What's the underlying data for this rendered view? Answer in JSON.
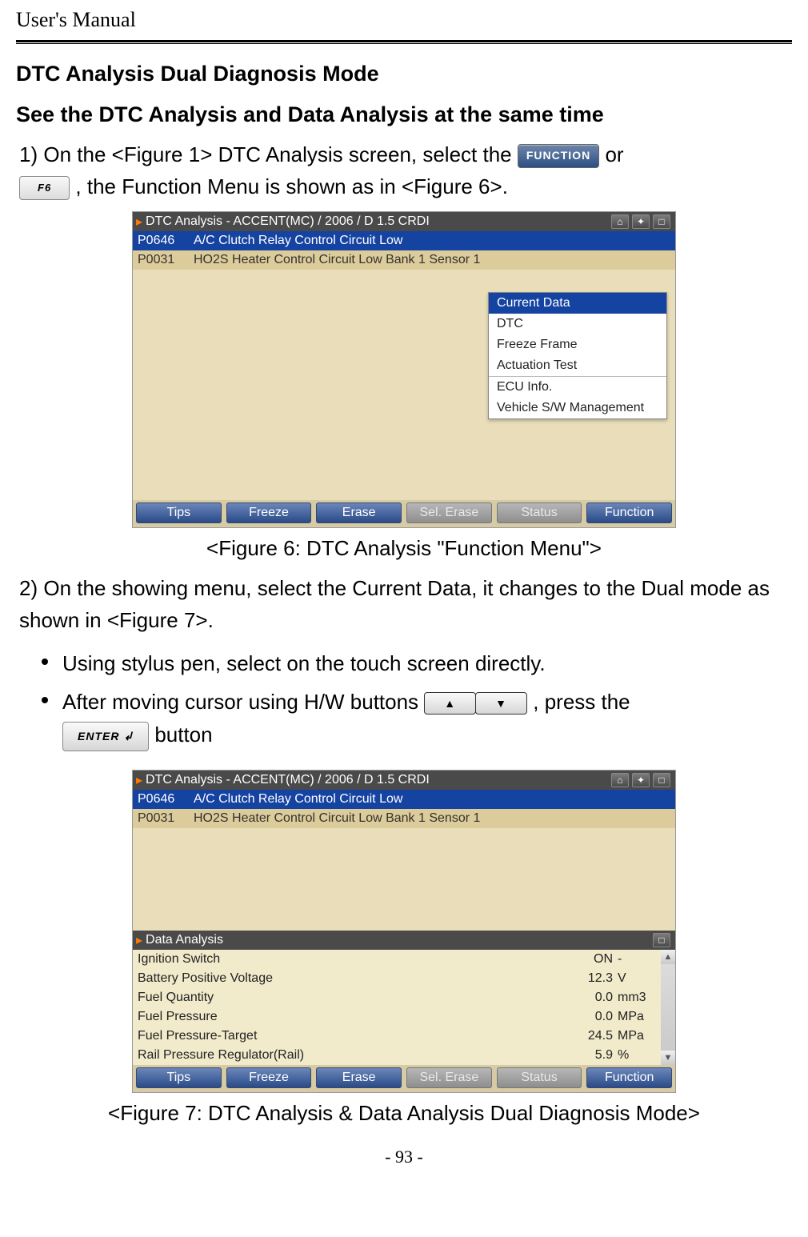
{
  "header": "User's Manual",
  "sectionTitle": "DTC Analysis Dual Diagnosis Mode",
  "subTitle": "See the DTC Analysis and Data Analysis at the same time",
  "step1": {
    "num": "1)",
    "pre": "On the <Figure 1> DTC Analysis screen, select the ",
    "functionLabel": "FUNCTION",
    "post": " or ",
    "f6Label": "F6",
    "tail": ", the Function Menu is shown as in <Figure 6>."
  },
  "panel1": {
    "title": "DTC Analysis - ACCENT(MC) / 2006 / D 1.5 CRDI",
    "dtc": [
      {
        "code": "P0646",
        "desc": "A/C Clutch Relay Control Circuit Low",
        "highlight": true
      },
      {
        "code": "P0031",
        "desc": "HO2S Heater Control Circuit Low Bank 1  Sensor 1",
        "highlight": false
      }
    ],
    "menu": [
      "Current Data",
      "DTC",
      "Freeze Frame",
      "Actuation Test",
      "ECU Info.",
      "Vehicle S/W Management"
    ],
    "buttons": [
      "Tips",
      "Freeze",
      "Erase",
      "Sel. Erase",
      "Status",
      "Function"
    ]
  },
  "caption1": "<Figure 6: DTC Analysis \"Function Menu\">",
  "step2": {
    "num": "2)",
    "text": "On the showing menu, select the Current Data, it changes to the Dual mode as shown in <Figure 7>."
  },
  "bullets": {
    "b1": "Using stylus pen, select on the touch screen directly.",
    "b2a": "After moving cursor using H/W buttons ",
    "b2b": ", press the ",
    "b2c": " button",
    "up": "▲",
    "down": "▼",
    "enter": "ENTER ↲"
  },
  "panel2": {
    "title": "DTC Analysis - ACCENT(MC) / 2006 / D 1.5 CRDI",
    "dtc": [
      {
        "code": "P0646",
        "desc": "A/C Clutch Relay Control Circuit Low",
        "highlight": true
      },
      {
        "code": "P0031",
        "desc": "HO2S Heater Control Circuit Low Bank 1  Sensor 1",
        "highlight": false
      }
    ],
    "dataTitle": "Data Analysis",
    "rows": [
      {
        "name": "Ignition Switch",
        "val": "ON",
        "unit": "-"
      },
      {
        "name": "Battery Positive Voltage",
        "val": "12.3",
        "unit": "V"
      },
      {
        "name": "Fuel Quantity",
        "val": "0.0",
        "unit": "mm3"
      },
      {
        "name": "Fuel Pressure",
        "val": "0.0",
        "unit": "MPa"
      },
      {
        "name": "Fuel Pressure-Target",
        "val": "24.5",
        "unit": "MPa"
      },
      {
        "name": "Rail Pressure Regulator(Rail)",
        "val": "5.9",
        "unit": "%"
      }
    ],
    "buttons": [
      "Tips",
      "Freeze",
      "Erase",
      "Sel. Erase",
      "Status",
      "Function"
    ]
  },
  "caption2": "<Figure 7: DTC Analysis & Data Analysis Dual Diagnosis Mode>",
  "pageNum": "- 93 -"
}
